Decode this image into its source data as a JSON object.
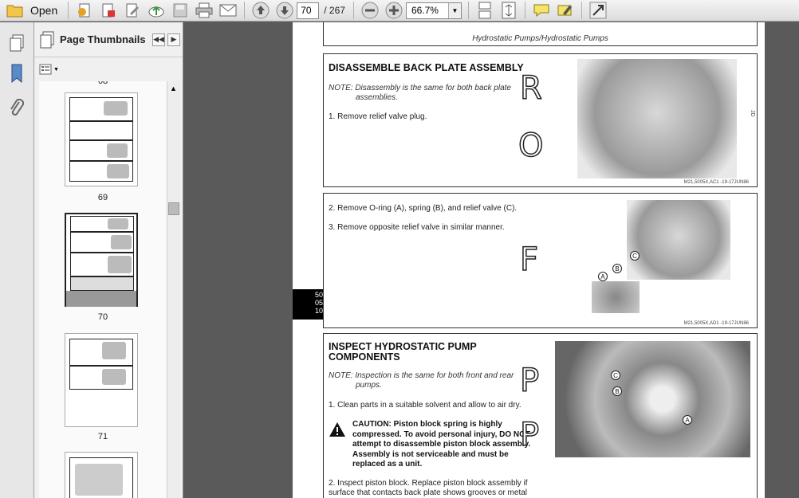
{
  "toolbar": {
    "open_label": "Open",
    "current_page": "70",
    "page_separator": "/ 267",
    "zoom": "66.7%"
  },
  "sidebar": {
    "title": "Page Thumbnails",
    "thumbnails": [
      {
        "label": "69"
      },
      {
        "label": "70"
      },
      {
        "label": "71"
      }
    ],
    "partial_top_label": "68"
  },
  "document": {
    "header_caption": "Hydrostatic Pumps/Hydrostatic Pumps",
    "section1": {
      "title": "DISASSEMBLE BACK PLATE ASSEMBLY",
      "note_line1": "NOTE: Disassembly is the same for both back plate",
      "note_line2": "assemblies.",
      "step1": "1. Remove relief valve plug.",
      "caption": "M21,5005X,AC1 -19-17JUN86"
    },
    "section2": {
      "step2": "2. Remove O-ring (A), spring (B), and relief valve (C).",
      "step3": "3. Remove opposite relief valve in similar manner.",
      "caption": "M21,5005X,AD1 -19-17JUN86",
      "callouts": [
        "A",
        "B",
        "C"
      ]
    },
    "section3": {
      "title_line1": "INSPECT HYDROSTATIC PUMP",
      "title_line2": "COMPONENTS",
      "note_line1": "NOTE: Inspection is the same for both front and rear",
      "note_line2": "pumps.",
      "step1": "1. Clean parts in a suitable solvent and allow to air dry.",
      "caution_line1": "CAUTION: Piston block spring is highly",
      "caution_line2": "compressed. To avoid personal injury, DO NOT",
      "caution_line3": "attempt to disassemble piston block assembly.",
      "caution_line4": "Assembly is not serviceable and must be",
      "caution_line5": "replaced as a unit.",
      "step2_line1": "2. Inspect piston block. Replace piston block assembly if",
      "step2_line2": "surface that contacts back plate shows grooves or metal",
      "callouts": [
        "C",
        "B",
        "A"
      ]
    },
    "section_marker": "50\n05\n10"
  }
}
